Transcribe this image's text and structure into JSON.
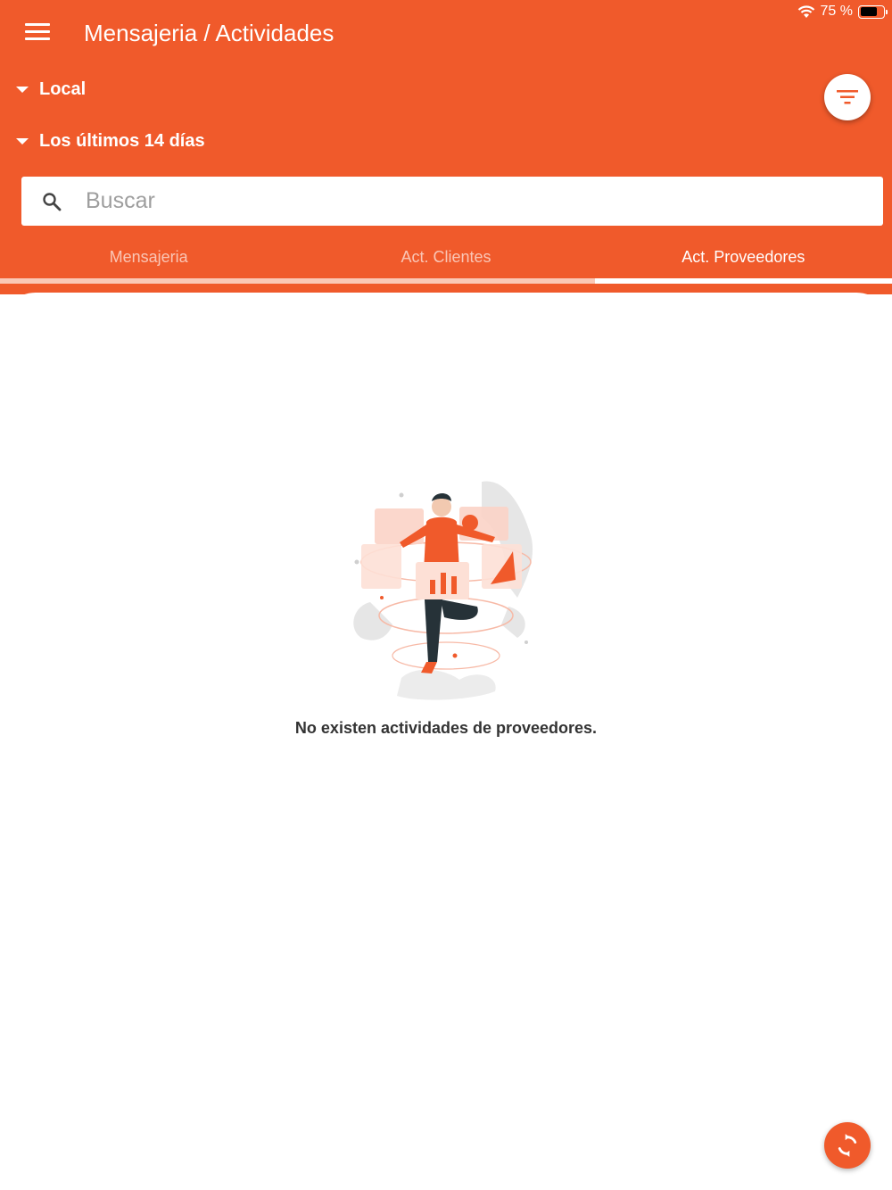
{
  "status_bar": {
    "battery_text": "75 %"
  },
  "header": {
    "title": "Mensajeria / Actividades"
  },
  "filters": {
    "location": "Local",
    "date_range": "Los últimos 14 días"
  },
  "search": {
    "placeholder": "Buscar"
  },
  "tabs": [
    {
      "label": "Mensajeria",
      "active": false
    },
    {
      "label": "Act. Clientes",
      "active": false
    },
    {
      "label": "Act. Proveedores",
      "active": true
    }
  ],
  "empty_state": {
    "message": "No existen actividades de proveedores."
  },
  "colors": {
    "primary": "#F05A2B",
    "tab_track": "#FAC8B6",
    "text_dark": "#333333"
  },
  "icons": {
    "menu": "menu-icon",
    "filter": "filter-icon",
    "search": "search-icon",
    "refresh": "refresh-icon",
    "wifi": "wifi-icon",
    "battery": "battery-icon"
  }
}
